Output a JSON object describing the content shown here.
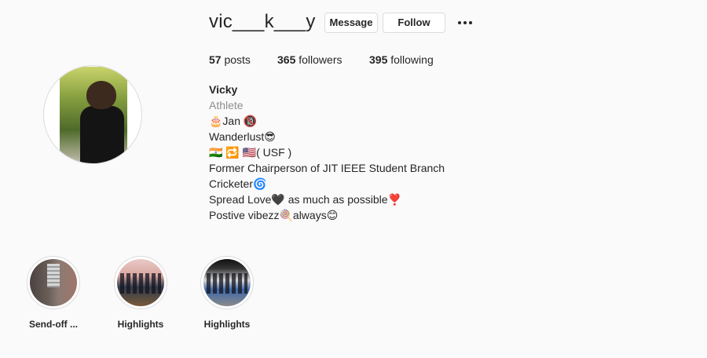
{
  "profile": {
    "username": "vic___k___y",
    "actions": {
      "message_label": "Message",
      "follow_label": "Follow",
      "more_icon": "more-horizontal-icon"
    },
    "stats": {
      "posts_count": "57",
      "posts_label": "posts",
      "followers_count": "365",
      "followers_label": "followers",
      "following_count": "395",
      "following_label": "following"
    },
    "bio": {
      "name": "Vicky",
      "category": "Athlete",
      "lines": [
        "🎂Jan 🔞",
        "Wanderlust😎",
        "🇮🇳 🔁 🇺🇸( USF )",
        "Former Chairperson of JIT IEEE Student Branch",
        "Cricketer🌀",
        "Spread Love🖤 as much as possible❣️",
        "Postive vibezz🍭always😊"
      ]
    }
  },
  "highlights": [
    {
      "label": "Send-off ..."
    },
    {
      "label": "Highlights"
    },
    {
      "label": "Highlights"
    }
  ]
}
